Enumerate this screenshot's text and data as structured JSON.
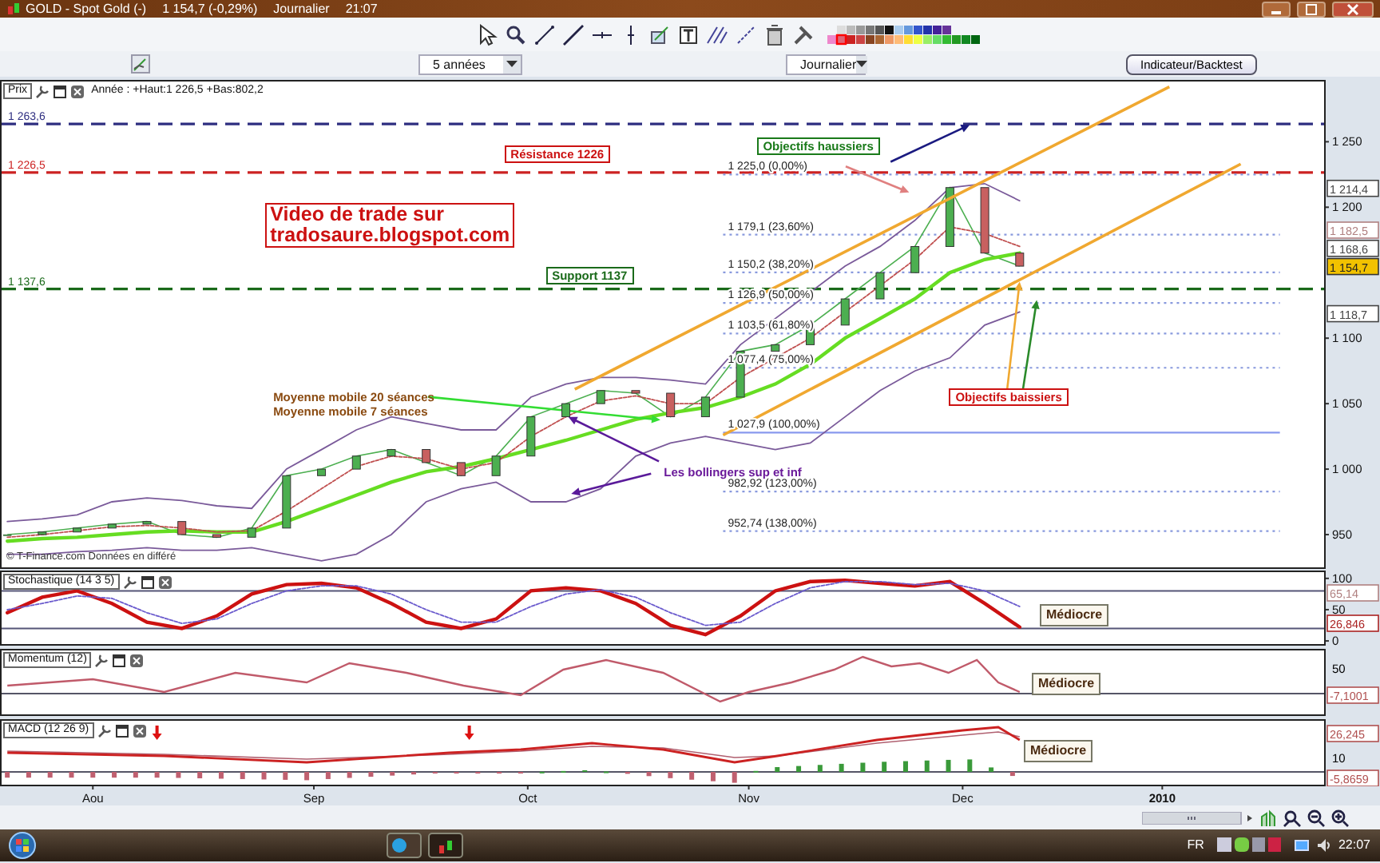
{
  "window": {
    "title": "GOLD - Spot Gold (-)",
    "quote": "1 154,7 (-0,29%)",
    "period": "Journalier",
    "time": "21:07"
  },
  "selectors": {
    "range": "5 années",
    "interval": "Journalier",
    "button": "Indicateur/Backtest"
  },
  "price_panel": {
    "label": "Prix",
    "summary": "Année : +Haut:1 226,5 +Bas:802,2",
    "source": "© T-Finance.com Données en différé",
    "fibonacci_levels": [
      "1 225,0 (0,00%)",
      "1 179,1 (23,60%)",
      "1 150,2 (38,20%)",
      "1 126,9 (50,00%)",
      "1 103,5 (61,80%)",
      "1 077,4 (75,00%)",
      "1 027,9 (100,00%)",
      "982,92 (123,00%)",
      "952,74 (138,00%)"
    ],
    "annotations": [
      {
        "kind": "box",
        "lines": [
          "Résistance 1226"
        ],
        "color": "#cc1111"
      },
      {
        "kind": "box",
        "lines": [
          "Objectifs haussiers"
        ],
        "color": "#1a7a1a"
      },
      {
        "kind": "banner",
        "lines": [
          "Video de trade sur",
          "tradosaure.blogspot.com"
        ],
        "color": "#cc1111"
      },
      {
        "kind": "box",
        "lines": [
          "Support 1137"
        ],
        "color": "#1a6a1a"
      },
      {
        "kind": "text",
        "lines": [
          "Moyenne mobile 20 séances",
          "Moyenne mobile 7 séances"
        ],
        "color": "#8a4a10"
      },
      {
        "kind": "box",
        "lines": [
          "Objectifs baissiers"
        ],
        "color": "#cc1111"
      },
      {
        "kind": "text",
        "lines": [
          "Les bollingers sup et inf"
        ],
        "color": "#6a1a9a"
      }
    ],
    "price_tags": [
      {
        "label": "1 214,4",
        "kind": "marker",
        "color": "#444444"
      },
      {
        "label": "1 182,5",
        "kind": "marker",
        "color": "#b08080"
      },
      {
        "label": "1 168,6",
        "kind": "marker",
        "color": "#444444"
      },
      {
        "label": "1 154,7",
        "kind": "last",
        "color": "#f2c200"
      },
      {
        "label": "1 118,7",
        "kind": "marker",
        "color": "#444444"
      }
    ],
    "chart_data": {
      "type": "line",
      "categories": [
        null,
        null,
        null,
        null,
        null,
        null,
        null,
        null,
        null,
        null,
        null,
        null,
        null,
        null,
        null,
        null,
        null,
        null,
        null,
        null,
        null,
        null,
        null,
        null,
        null,
        null,
        null,
        null,
        null,
        null
      ],
      "series": [
        {
          "color": "#4caf50",
          "values": [
            950,
            952,
            955,
            958,
            960,
            950,
            948,
            955,
            995,
            1000,
            1010,
            1015,
            1005,
            995,
            1010,
            1040,
            1050,
            1060,
            1058,
            1040,
            1055,
            1090,
            1095,
            1110,
            1130,
            1150,
            1170,
            1215,
            1165,
            1155
          ]
        },
        {
          "color": "#66dd22",
          "values": [
            945,
            947,
            948,
            950,
            952,
            953,
            952,
            952,
            960,
            970,
            980,
            990,
            998,
            1002,
            1008,
            1015,
            1022,
            1030,
            1038,
            1043,
            1047,
            1055,
            1065,
            1080,
            1100,
            1115,
            1130,
            1150,
            1160,
            1165
          ]
        },
        {
          "color": "#c05050",
          "line_style": "dashed",
          "values": [
            948,
            950,
            953,
            956,
            957,
            955,
            952,
            953,
            968,
            985,
            1002,
            1010,
            1008,
            1000,
            1005,
            1025,
            1040,
            1052,
            1056,
            1050,
            1050,
            1070,
            1085,
            1100,
            1120,
            1140,
            1160,
            1185,
            1180,
            1170
          ]
        },
        {
          "color": "#7a5a9a",
          "values": [
            960,
            962,
            965,
            975,
            978,
            976,
            972,
            970,
            1000,
            1015,
            1030,
            1040,
            1035,
            1030,
            1030,
            1055,
            1065,
            1070,
            1070,
            1068,
            1065,
            1095,
            1115,
            1135,
            1155,
            1170,
            1190,
            1215,
            1218,
            1205
          ]
        },
        {
          "color": "#7a5a9a",
          "values": [
            935,
            935,
            937,
            938,
            940,
            938,
            938,
            940,
            935,
            930,
            935,
            950,
            975,
            985,
            990,
            975,
            975,
            985,
            1010,
            1020,
            1025,
            1020,
            1015,
            1020,
            1040,
            1060,
            1075,
            1085,
            1110,
            1120
          ]
        }
      ],
      "ylim": [
        925,
        1296
      ],
      "ref_lines": [
        {
          "axis": "y",
          "value": 1263.6,
          "label": "1 263,6",
          "color": "#2e2e80",
          "line_style": "dashed"
        },
        {
          "axis": "y",
          "value": 1226.5,
          "label": "1 226,5",
          "color": "#cc2222",
          "line_style": "dashed"
        },
        {
          "axis": "y",
          "value": 1137.6,
          "label": "1 137,6",
          "color": "#1a6a1a",
          "line_style": "dashed"
        }
      ],
      "yticks": [
        {
          "value": 950,
          "label": "950"
        },
        {
          "value": 1000,
          "label": "1 000"
        },
        {
          "value": 1050,
          "label": "1 050"
        },
        {
          "value": 1100,
          "label": "1 100"
        },
        {
          "value": 1200,
          "label": "1 200"
        },
        {
          "value": 1250,
          "label": "1 250"
        }
      ]
    }
  },
  "stochastic": {
    "label": "Stochastique (14 3 5)",
    "comment": "Médiocre",
    "tags": [
      {
        "label": "65,14",
        "color": "#b08080"
      },
      {
        "label": "26,846",
        "color": "#aa2222"
      }
    ],
    "chart_data": {
      "type": "line",
      "categories": [
        null,
        null,
        null,
        null,
        null,
        null,
        null,
        null,
        null,
        null,
        null,
        null,
        null,
        null,
        null,
        null,
        null,
        null,
        null,
        null,
        null,
        null,
        null,
        null,
        null,
        null,
        null,
        null,
        null,
        null
      ],
      "series": [
        {
          "color": "#cc1111",
          "values": [
            45,
            70,
            80,
            60,
            30,
            20,
            40,
            75,
            90,
            92,
            85,
            60,
            30,
            20,
            35,
            80,
            85,
            80,
            60,
            25,
            10,
            40,
            80,
            95,
            97,
            92,
            88,
            95,
            60,
            22
          ]
        },
        {
          "color": "#6a5acd",
          "line_style": "dashed",
          "values": [
            50,
            60,
            72,
            68,
            45,
            28,
            35,
            60,
            80,
            88,
            88,
            75,
            50,
            30,
            30,
            55,
            75,
            82,
            70,
            45,
            25,
            30,
            60,
            85,
            95,
            95,
            90,
            92,
            80,
            55
          ]
        }
      ],
      "ylim": [
        -5,
        110
      ],
      "ref_lines": [
        {
          "axis": "y",
          "value": 80,
          "color": "#555577"
        },
        {
          "axis": "y",
          "value": 20,
          "color": "#555577"
        }
      ],
      "yticks": [
        {
          "value": 0,
          "label": "0"
        },
        {
          "value": 50,
          "label": "50"
        },
        {
          "value": 100,
          "label": "100"
        }
      ]
    }
  },
  "momentum": {
    "label": "Momentum (12)",
    "tick": "50",
    "tag": "-7,1001",
    "comment": "Médiocre"
  },
  "macd": {
    "label": "MACD (12 26 9)",
    "tick": "10",
    "tags": [
      "26,245",
      "-5,8659"
    ],
    "comment": "Médiocre"
  },
  "x_axis": [
    "Aou",
    "Sep",
    "Oct",
    "Nov",
    "Dec",
    "2010"
  ],
  "taskbar": {
    "language": "FR",
    "clock": "22:07"
  }
}
